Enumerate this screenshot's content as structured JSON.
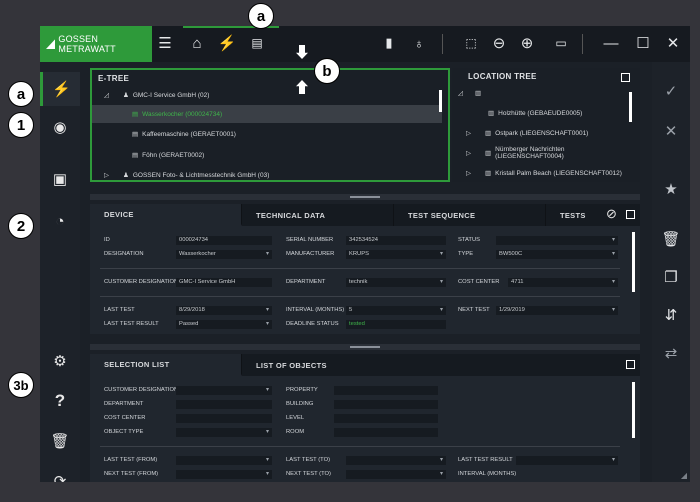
{
  "brand": {
    "name": "GOSSEN METRAWATT",
    "accent": "#2e9a3a"
  },
  "annotations": {
    "a_top": "a",
    "b": "b",
    "a_left": "a",
    "one": "1",
    "two": "2",
    "three_b": "3b"
  },
  "toolbar": {
    "icons": [
      "menu-icon",
      "home-icon",
      "plug-icon",
      "monitor-list-icon",
      "door-icon",
      "bulb-icon",
      "select-icon",
      "zoom-out-icon",
      "zoom-in-icon",
      "card-icon",
      "minimize-icon",
      "maximize-icon",
      "close-icon"
    ]
  },
  "etree": {
    "title": "E-TREE",
    "rows": [
      {
        "label": "GMC-I Service GmbH (02)"
      },
      {
        "label": "Wasserkocher (000024734)"
      },
      {
        "label": "Kaffeemaschine (GERAET0001)"
      },
      {
        "label": "Föhn (GERAET0002)"
      },
      {
        "label": "GOSSEN Foto- & Lichtmesstechnik GmbH (03)"
      }
    ]
  },
  "loctree": {
    "title": "LOCATION TREE",
    "rows": [
      {
        "label": "Holzhütte (GEBAEUDE0005)"
      },
      {
        "label": "Ostpark (LIEGENSCHAFT0001)"
      },
      {
        "label": "Nürnberger Nachrichten (LIEGENSCHAFT0004)"
      },
      {
        "label": "Kristall Palm Beach (LIEGENSCHAFT0012)"
      }
    ]
  },
  "device_tabs": [
    "DEVICE",
    "TECHNICAL DATA",
    "TEST SEQUENCE",
    "TESTS"
  ],
  "device": {
    "id_label": "ID",
    "id_value": "000024734",
    "serial_label": "SERIAL NUMBER",
    "serial_value": "342534524",
    "status_label": "STATUS",
    "status_value": "",
    "designation_label": "DESIGNATION",
    "designation_value": "Wasserkocher",
    "manufacturer_label": "MANUFACTURER",
    "manufacturer_value": "KRUPS",
    "type_label": "TYPE",
    "type_value": "BW500C",
    "custdes_label": "CUSTOMER DESIGNATION",
    "custdes_value": "GMC-I Service GmbH",
    "dept_label": "DEPARTMENT",
    "dept_value": "technik",
    "cost_label": "COST CENTER",
    "cost_value": "4711",
    "lasttest_label": "LAST TEST",
    "lasttest_value": "8/29/2018",
    "interval_label": "INTERVAL (MONTHS)",
    "interval_value": "5",
    "nexttest_label": "NEXT TEST",
    "nexttest_value": "1/29/2019",
    "lastresult_label": "LAST TEST RESULT",
    "lastresult_value": "Passed",
    "deadline_label": "DEADLINE STATUS",
    "deadline_value": "tested"
  },
  "selection_tabs": [
    "SELECTION LIST",
    "LIST OF OBJECTS"
  ],
  "selection": {
    "custdes": "CUSTOMER DESIGNATION",
    "property": "PROPERTY",
    "department": "DEPARTMENT",
    "building": "BUILDING",
    "cost": "COST CENTER",
    "level": "LEVEL",
    "objtype": "OBJECT TYPE",
    "room": "ROOM",
    "lastfrom": "LAST TEST (FROM)",
    "lastto": "LAST TEST (TO)",
    "lastresult": "LAST TEST RESULT",
    "nextfrom": "NEXT TEST (FROM)",
    "nextto": "NEXT TEST (TO)",
    "interval": "INTERVAL (MONTHS)"
  }
}
